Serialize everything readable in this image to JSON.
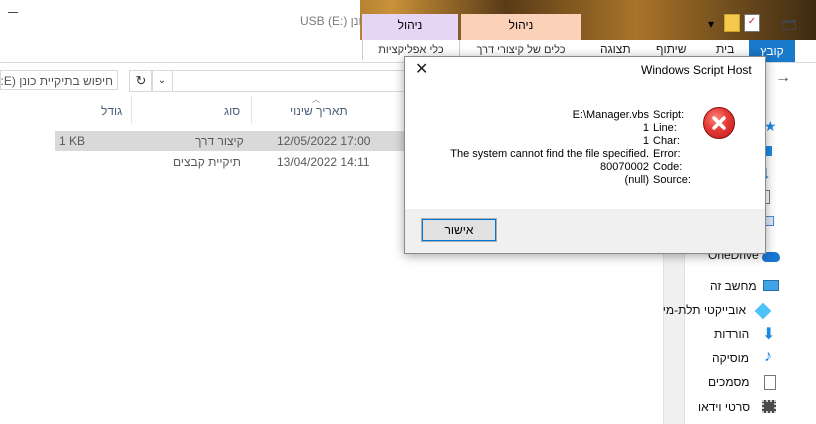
{
  "window": {
    "title": "כונן USB (E:)",
    "contextual_tabs": {
      "app_tools": {
        "group": "ניהול",
        "tab": "כלי אפליקציות"
      },
      "link_tools": {
        "group": "ניהול",
        "tab": "כלים של קיצורי דרך"
      }
    }
  },
  "ribbon": {
    "file": "קובץ",
    "home": "בית",
    "share": "שיתוף",
    "view": "תצוגה"
  },
  "search": {
    "placeholder": "חיפוש בתיקיית כונן (E:)"
  },
  "columns": {
    "date": "תאריך שינוי",
    "type": "סוג",
    "size": "גודל"
  },
  "files": [
    {
      "date": "12/05/2022 17:00",
      "type": "קיצור דרך",
      "size": "1 KB",
      "selected": true
    },
    {
      "date": "13/04/2022 14:11",
      "type": "תיקיית קבצים",
      "size": "",
      "selected": false
    }
  ],
  "nav": {
    "items": [
      {
        "label": "OneDrive",
        "icon": "onedrive-cloud-icon"
      },
      {
        "label": "מחשב זה",
        "icon": "this-pc-icon"
      },
      {
        "label": "אובייקטי תלת-מימד",
        "icon": "3d-objects-icon"
      },
      {
        "label": "הורדות",
        "icon": "downloads-icon"
      },
      {
        "label": "מוסיקה",
        "icon": "music-icon"
      },
      {
        "label": "מסמכים",
        "icon": "documents-icon"
      },
      {
        "label": "סרטי וידאו",
        "icon": "videos-icon"
      }
    ]
  },
  "dialog": {
    "title": "Windows Script Host",
    "labels": [
      "Script:",
      "Line:",
      "Char:",
      "Error:",
      "Code:",
      "Source:"
    ],
    "values": [
      "E:\\Manager.vbs",
      "1",
      "1",
      "The system cannot find the file specified.",
      "80070002",
      "(null)"
    ],
    "ok_label": "אישור",
    "icon": "error-icon"
  },
  "colors": {
    "accent": "#1979ca",
    "error": "#e53935",
    "selected_row": "#d9d9d9"
  }
}
